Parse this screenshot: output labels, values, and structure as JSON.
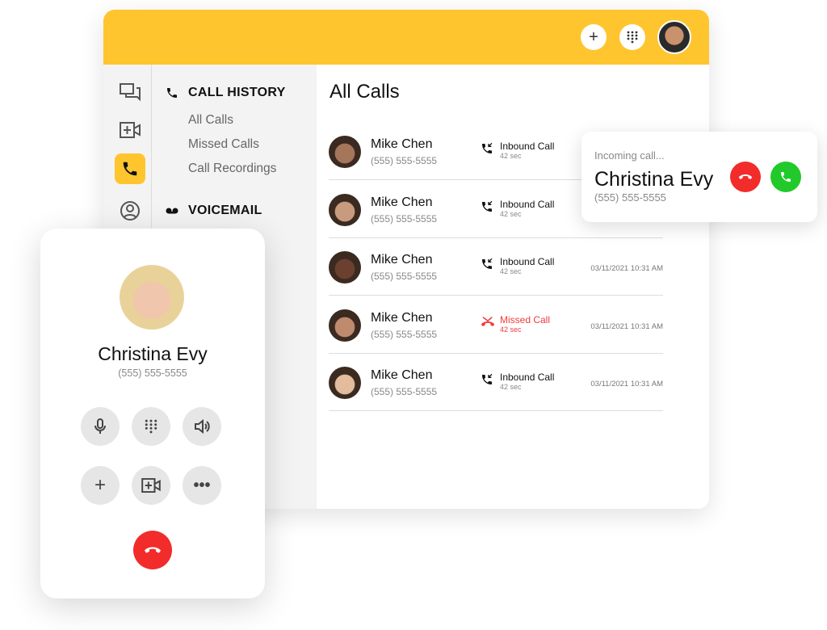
{
  "header": {
    "add_icon": "plus",
    "dialpad_icon": "dialpad",
    "avatar": "user-avatar"
  },
  "rail": [
    "chat-icon",
    "video-add-icon",
    "phone-icon",
    "contact-icon"
  ],
  "nav": {
    "call_history": "CALL HISTORY",
    "items": [
      "All Calls",
      "Missed Calls",
      "Call Recordings"
    ],
    "voicemail": "VOICEMAIL"
  },
  "main": {
    "title": "All Calls",
    "rows": [
      {
        "name": "Mike Chen",
        "phone": "(555) 555-5555",
        "type": "Inbound Call",
        "duration": "42 sec",
        "date": "",
        "missed": false,
        "skin": "#a5765a"
      },
      {
        "name": "Mike Chen",
        "phone": "(555) 555-5555",
        "type": "Inbound Call",
        "duration": "42 sec",
        "date": "",
        "missed": false,
        "skin": "#c99b7e"
      },
      {
        "name": "Mike Chen",
        "phone": "(555) 555-5555",
        "type": "Inbound Call",
        "duration": "42 sec",
        "date": "03/11/2021 10:31 AM",
        "missed": false,
        "skin": "#6b4030"
      },
      {
        "name": "Mike Chen",
        "phone": "(555) 555-5555",
        "type": "Missed Call",
        "duration": "42 sec",
        "date": "03/11/2021 10:31 AM",
        "missed": true,
        "skin": "#c08a6e"
      },
      {
        "name": "Mike Chen",
        "phone": "(555) 555-5555",
        "type": "Inbound Call",
        "duration": "42 sec",
        "date": "03/11/2021 10:31 AM",
        "missed": false,
        "skin": "#e2bc9c"
      }
    ]
  },
  "incoming": {
    "label": "Incoming call...",
    "name": "Christina Evy",
    "phone": "(555) 555-5555"
  },
  "phone": {
    "name": "Christina Evy",
    "number": "(555) 555-5555"
  },
  "colors": {
    "accent": "#FFC52E",
    "decline": "#F22B2B",
    "accept": "#22C92A",
    "missed": "#F23B3B"
  }
}
